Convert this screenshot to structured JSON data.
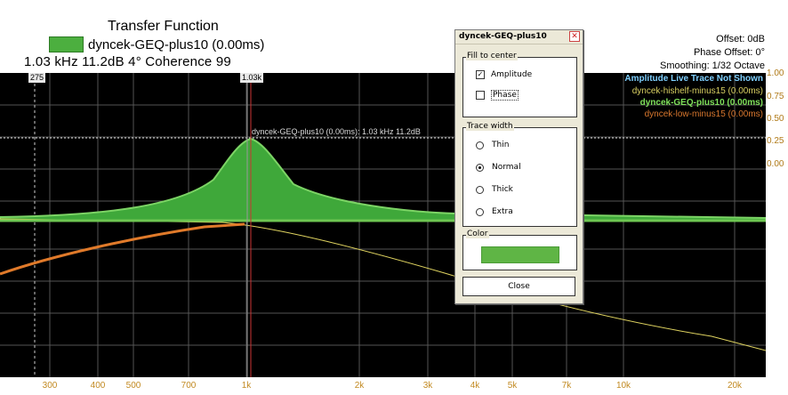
{
  "header": {
    "title": "Transfer Function",
    "legend_label": "dyncek-GEQ-plus10 (0.00ms)",
    "cursor_readout": "1.03 kHz 11.2dB  4°  Coherence  99"
  },
  "info": {
    "offset": "Offset: 0dB",
    "phase_offset": "Phase Offset: 0°",
    "smoothing": "Smoothing: 1/32 Octave"
  },
  "legend_lines": [
    {
      "text": "Amplitude Live Trace Not Shown",
      "color": "#7fd0ff"
    },
    {
      "text": "dyncek-hishelf-minus15 (0.00ms)",
      "color": "#d8cf62"
    },
    {
      "text": "dyncek-GEQ-plus10 (0.00ms)",
      "color": "#7fe05a"
    },
    {
      "text": "dyncek-low-minus15 (0.00ms)",
      "color": "#d8772e"
    }
  ],
  "right_axis": [
    "1.00",
    "0.75",
    "0.50",
    "0.25",
    "0.00"
  ],
  "markers": {
    "left": "275",
    "center": "1.03k"
  },
  "trace_label": "dyncek-GEQ-plus10 (0.00ms): 1.03 kHz 11.2dB",
  "x_ticks": [
    "300",
    "400",
    "500",
    "700",
    "1k",
    "2k",
    "3k",
    "4k",
    "5k",
    "7k",
    "10k",
    "20k"
  ],
  "colors": {
    "geq": "#3fa83a",
    "low": "#e07a2a",
    "hishelf": "#e0d460"
  },
  "dialog": {
    "title": "dyncek-GEQ-plus10",
    "fill_group": "Fill to center",
    "amplitude": "Amplitude",
    "phase": "Phase",
    "trace_group": "Trace width",
    "thin": "Thin",
    "normal": "Normal",
    "thick": "Thick",
    "extra": "Extra",
    "color_group": "Color",
    "close": "Close"
  }
}
